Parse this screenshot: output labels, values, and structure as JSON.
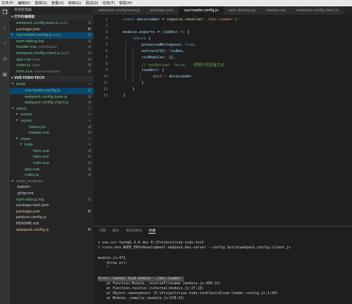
{
  "menubar": [
    "文件(F)",
    "编辑(E)",
    "选择(S)",
    "查看(V)",
    "转到(G)",
    "调试(D)",
    "任务(T)",
    "帮助(H)"
  ],
  "activity_icons": [
    "files-icon",
    "search-icon",
    "git-icon",
    "debug-icon",
    "extensions-icon"
  ],
  "sidebar": {
    "title": "资源管理器",
    "open_editors_title": "▾ 打开的编辑器",
    "open_editors": [
      {
        "label": "webpack.config.base.js",
        "hint": "build",
        "status": "U",
        "color": "g"
      },
      {
        "label": "package.json",
        "hint": "",
        "status": "M",
        "color": "o"
      },
      {
        "label": "vue-loader.config.js",
        "hint": "build",
        "status": "U",
        "color": "g",
        "selected": true,
        "close": "×"
      },
      {
        "label": "npm-debug.log",
        "hint": "",
        "status": "U",
        "color": "g"
      },
      {
        "label": "header.vue",
        "hint": "client\\layout",
        "status": "U",
        "color": "g"
      },
      {
        "label": "webpack.config.client.js",
        "hint": "build",
        "status": "U",
        "color": "g"
      },
      {
        "label": "app.vue",
        "hint": "client",
        "status": "U",
        "color": "g"
      },
      {
        "label": "index.js",
        "hint": "client",
        "status": "U",
        "color": "g"
      },
      {
        "label": "item.vue",
        "hint": "client\\views\\todo",
        "status": "U",
        "color": "g"
      }
    ],
    "project_title": "▾ VUE-TODO-TECH",
    "tree": [
      {
        "label": "build",
        "indent": 0,
        "arrow": "▾",
        "status": "•",
        "color": "g"
      },
      {
        "label": "vue-loader.config.js",
        "indent": 2,
        "arrow": "",
        "status": "U",
        "color": "g",
        "selected": true
      },
      {
        "label": "webpack.config.base.js",
        "indent": 2,
        "arrow": "",
        "status": "U",
        "color": "g"
      },
      {
        "label": "webpack.config.client.js",
        "indent": 2,
        "arrow": "",
        "status": "U",
        "color": "g"
      },
      {
        "label": "client",
        "indent": 0,
        "arrow": "▾",
        "status": "•",
        "color": "g"
      },
      {
        "label": "assets",
        "indent": 1,
        "arrow": "▸",
        "status": "•",
        "color": "g"
      },
      {
        "label": "layout",
        "indent": 1,
        "arrow": "▾",
        "status": "•",
        "color": "g"
      },
      {
        "label": "footer.jsx",
        "indent": 3,
        "arrow": "",
        "status": "U",
        "color": "g"
      },
      {
        "label": "header.vue",
        "indent": 3,
        "arrow": "",
        "status": "U",
        "color": "g"
      },
      {
        "label": "views",
        "indent": 1,
        "arrow": "▾",
        "status": "•",
        "color": "g"
      },
      {
        "label": "todo",
        "indent": 2,
        "arrow": "▾",
        "status": "•",
        "color": "g"
      },
      {
        "label": "item.vue",
        "indent": 4,
        "arrow": "",
        "status": "U",
        "color": "g"
      },
      {
        "label": "tabs.vue",
        "indent": 4,
        "arrow": "",
        "status": "U",
        "color": "g"
      },
      {
        "label": "todo.vue",
        "indent": 4,
        "arrow": "",
        "status": "U",
        "color": "g"
      },
      {
        "label": "app.vue",
        "indent": 2,
        "arrow": "",
        "status": "U",
        "color": "g"
      },
      {
        "label": "index.js",
        "indent": 2,
        "arrow": "",
        "status": "U",
        "color": "g"
      },
      {
        "label": "node_modules",
        "indent": 0,
        "arrow": "▸",
        "status": "",
        "color": "d"
      },
      {
        "label": ".babelrc",
        "indent": 0,
        "arrow": "",
        "status": "",
        "color": "w"
      },
      {
        "label": ".gitignore",
        "indent": 0,
        "arrow": "",
        "status": "",
        "color": "w"
      },
      {
        "label": "npm-debug.log",
        "indent": 0,
        "arrow": "",
        "status": "U",
        "color": "g"
      },
      {
        "label": "package-lock.json",
        "indent": 0,
        "arrow": "",
        "status": "",
        "color": "w"
      },
      {
        "label": "package.json",
        "indent": 0,
        "arrow": "",
        "status": "M",
        "color": "o"
      },
      {
        "label": "postcss.config.js",
        "indent": 0,
        "arrow": "",
        "status": "",
        "color": "w"
      },
      {
        "label": "README.md",
        "indent": 0,
        "arrow": "",
        "status": "",
        "color": "w"
      },
      {
        "label": "webpack.config.js",
        "indent": 0,
        "arrow": "",
        "status": "M",
        "color": "o"
      }
    ]
  },
  "tabs": [
    {
      "label": "webpack.config.base.js",
      "active": false
    },
    {
      "label": "package.json",
      "active": false
    },
    {
      "label": "vue-loader.config.js",
      "active": true
    },
    {
      "label": "npm-debug.log",
      "active": false
    },
    {
      "label": "header.vue",
      "active": false
    },
    {
      "label": "webpack.config.client.js",
      "active": false
    }
  ],
  "editor": {
    "line_numbers": [
      "1",
      "2",
      "3",
      "4",
      "5",
      "6",
      "7",
      "8",
      "9",
      "10",
      "11",
      "12",
      "13"
    ]
  },
  "panel": {
    "tabs": [
      "问题",
      "输出",
      "调试控制台",
      "终端"
    ],
    "active_tab": "终端",
    "terminal_lines": [
      "",
      "> vue-ssr-tech@1.0.0 dev E:\\Projects\\vue-todo-tech",
      "> cross-env NODE_ENV=development webpack-dev-server --config build/webpack.config.client.js",
      "",
      "module.js:471",
      "    throw err;",
      "    ^",
      "",
      "Error: Cannot find module './doc-loader'",
      "    at Function.Module._resolveFilename (module.js:469:15)",
      "    at Function.resolve (internal/module.js:27:19)",
      "    at Object.<anonymous> (E:\\Projects\\vue-todo-tech\\build\\vue-loader.config.js:1:90)",
      "    at Module._compile (module.js:570:32)"
    ],
    "error_line_index": 8
  },
  "colors": {
    "accent": "#007acc",
    "selection": "#094771",
    "untracked": "#73c991",
    "modified": "#e2c08d"
  }
}
